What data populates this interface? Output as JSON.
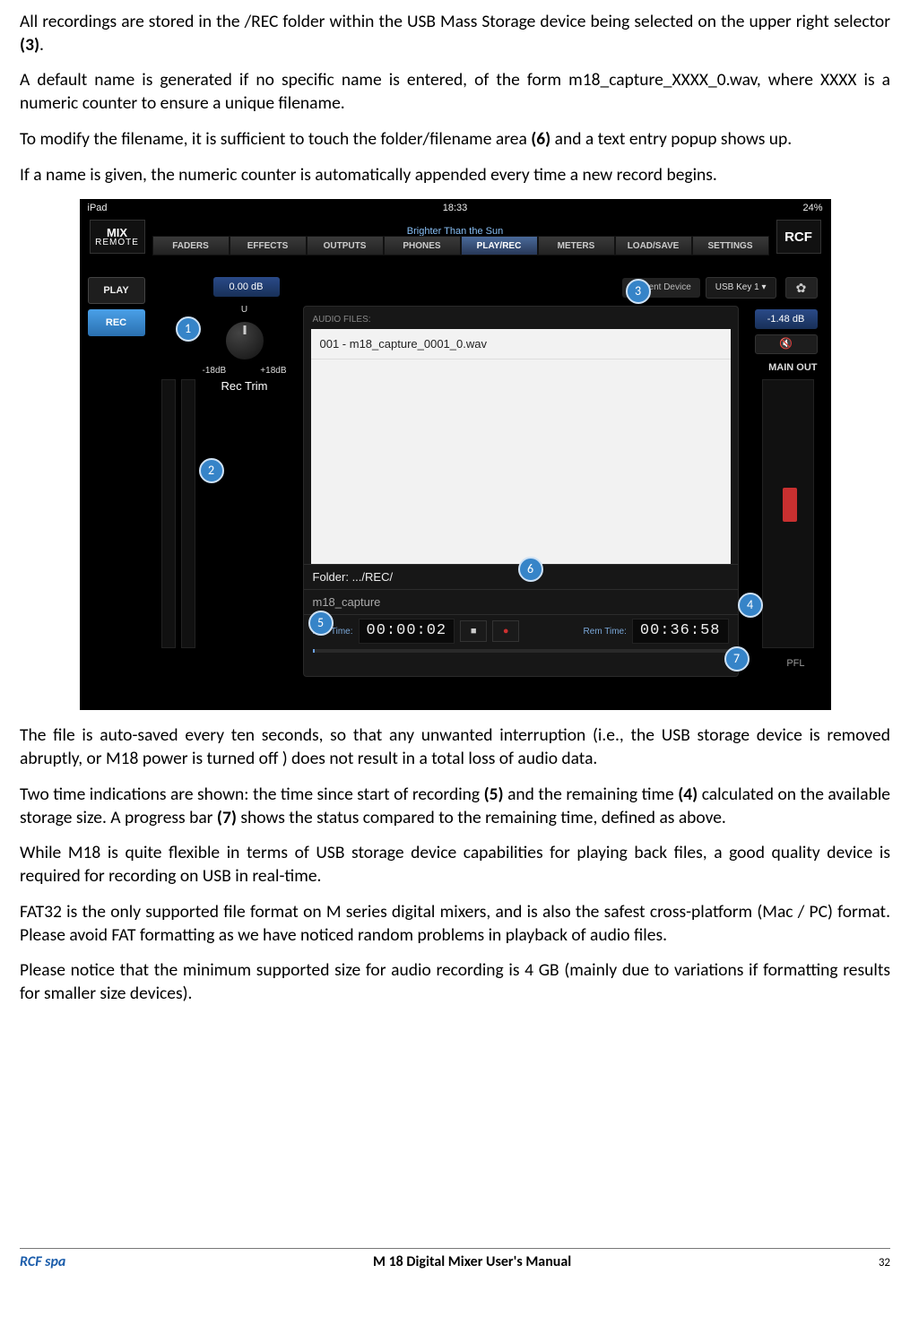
{
  "paragraphs": {
    "p1a": "All recordings are stored in the /REC folder within  the USB Mass Storage device being selected on the upper right selector ",
    "p1b": "(3)",
    "p1c": ".",
    "p2": "A default name is generated if no specific name is entered, of the form m18_capture_XXXX_0.wav, where XXXX is a numeric counter to ensure a unique filename.",
    "p3a": "To modify the filename, it is sufficient to touch the folder/filename area ",
    "p3b": "(6)",
    "p3c": " and a text entry popup shows up.",
    "p4": "If a name is given, the numeric counter is automatically appended every time a new record begins.",
    "p5": "The file is auto-saved every ten seconds, so that any unwanted interruption (i.e., the USB storage device is removed abruptly, or M18 power is turned off ) does not result in a total loss of audio data.",
    "p6a": "Two time indications are shown: the time since start of recording ",
    "p6b": "(5)",
    "p6c": " and the remaining time ",
    "p6d": "(4)",
    "p6e": " calculated on the available storage size. A progress bar ",
    "p6f": "(7)",
    "p6g": " shows the status compared to the remaining time, defined as above.",
    "p7": "While M18 is quite flexible in terms of USB storage device capabilities for playing back files, a good quality device is required for recording on USB in real-time.",
    "p8": "FAT32 is the only supported file format on M series digital mixers, and is also the safest cross-platform (Mac / PC) format. Please avoid FAT formatting as we have noticed random problems in playback of audio files.",
    "p9": "Please notice that the minimum supported size for audio recording is 4 GB (mainly due to variations if formatting results for smaller size devices)."
  },
  "screenshot": {
    "ipad_left": "iPad",
    "ipad_time": "18:33",
    "ipad_right": "24%",
    "logo_line1": "MIX",
    "logo_line2": "REMOTE",
    "rcf": "RCF",
    "song": "Brighter Than the Sun",
    "tabs": [
      "FADERS",
      "EFFECTS",
      "OUTPUTS",
      "PHONES",
      "PLAY/REC",
      "METERS",
      "LOAD/SAVE",
      "SETTINGS"
    ],
    "play": "PLAY",
    "rec": "REC",
    "db_top": "0.00 dB",
    "device_label": "Current Device",
    "device_value": "USB Key 1  ▾",
    "gear": "✿",
    "right_db": "-1.48 dB",
    "vol": "🔇",
    "main_out": "MAIN OUT",
    "pfl": "PFL",
    "rectrim_u": "U",
    "rectrim_minus": "-18dB",
    "rectrim_plus": "+18dB",
    "rectrim_title": "Rec Trim",
    "audio_header": "AUDIO FILES:",
    "audio_item": "001 - m18_capture_0001_0.wav",
    "folder": "Folder: .../REC/",
    "filename": "m18_capture",
    "rec_time_label": "Rec Time:",
    "rec_time": "00:00:02",
    "stop": "■",
    "recdot": "●",
    "rem_time_label": "Rem Time:",
    "rem_time": "00:36:58"
  },
  "bubbles": {
    "b1": "1",
    "b2": "2",
    "b3": "3",
    "b4": "4",
    "b5": "5",
    "b6": "6",
    "b7": "7"
  },
  "footer": {
    "left": "RCF spa",
    "center": "M 18 Digital Mixer User's Manual",
    "page": "32"
  }
}
